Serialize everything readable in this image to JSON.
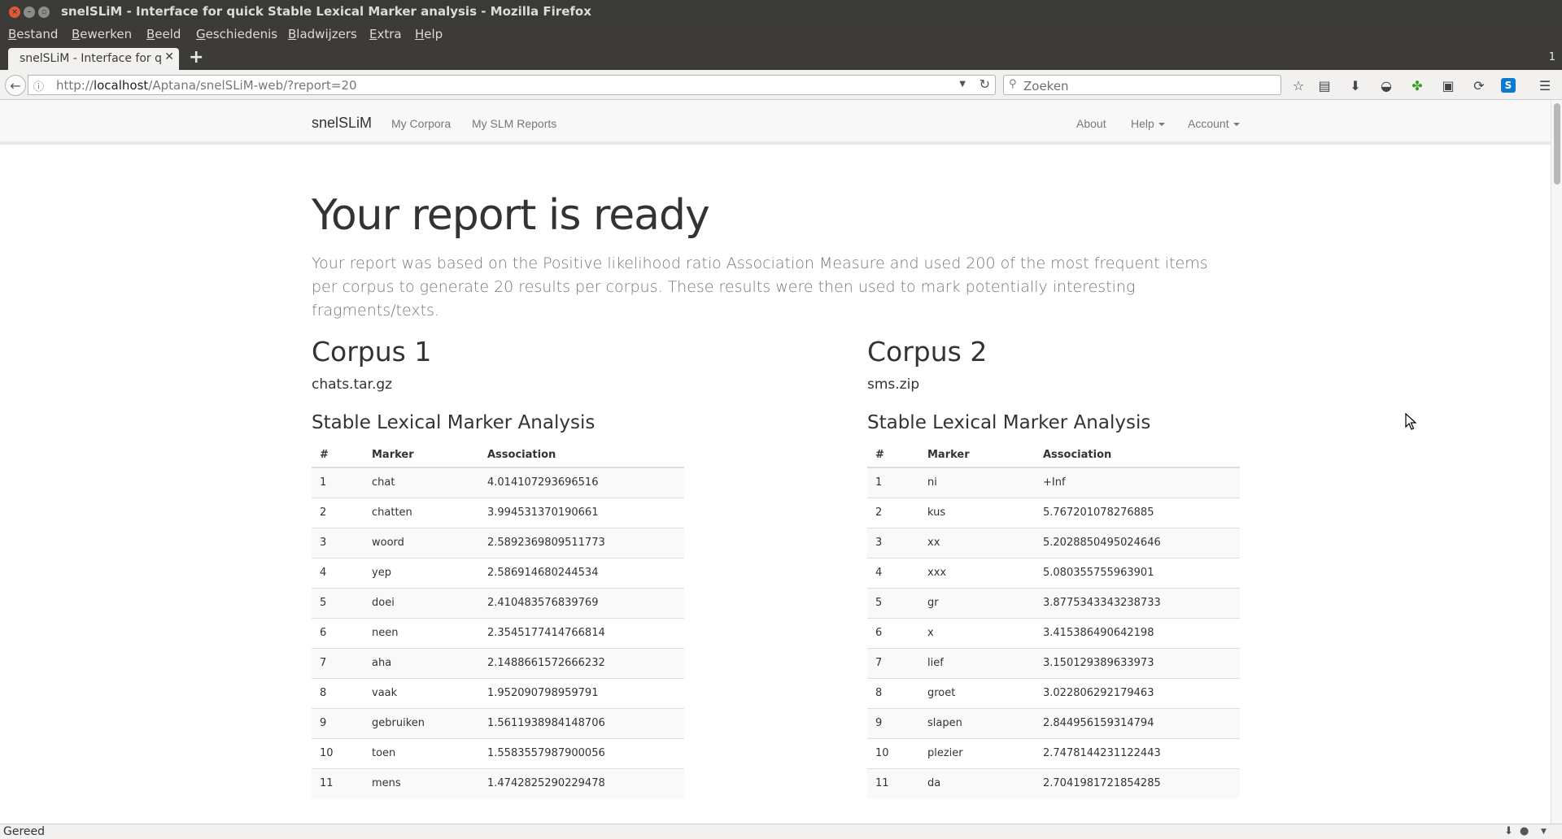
{
  "window": {
    "title": "snelSLiM - Interface for quick Stable Lexical Marker analysis - Mozilla Firefox"
  },
  "menubar": {
    "items": [
      {
        "u": "B",
        "rest": "estand"
      },
      {
        "u": "B",
        "rest": "ewerken"
      },
      {
        "u": "B",
        "rest": "eeld"
      },
      {
        "u": "G",
        "rest": "eschiedenis"
      },
      {
        "u": "B",
        "rest": "ladwijzers"
      },
      {
        "u": "E",
        "rest": "xtra"
      },
      {
        "u": "H",
        "rest": "elp"
      }
    ]
  },
  "tabs": {
    "active_label": "snelSLiM - Interface for q",
    "count": "1"
  },
  "nav": {
    "url_prefix": "http://",
    "url_host": "localhost",
    "url_path": "/Aptana/snelSLiM-web/?report=20",
    "search_placeholder": "Zoeken"
  },
  "site": {
    "brand": "snelSLiM",
    "links_left": [
      "My Corpora",
      "My SLM Reports"
    ],
    "about": "About",
    "help": "Help",
    "account": "Account"
  },
  "report": {
    "heading": "Your report is ready",
    "lead": "Your report was based on the Positive likelihood ratio Association Measure and used 200 of the most frequent items per corpus to generate 20 results per corpus. These results were then used to mark potentially interesting fragments/texts.",
    "section_title": "Stable Lexical Marker Analysis",
    "columns": [
      "#",
      "Marker",
      "Association"
    ],
    "corpora": [
      {
        "title": "Corpus 1",
        "file": "chats.tar.gz",
        "rows": [
          [
            "1",
            "chat",
            "4.014107293696516"
          ],
          [
            "2",
            "chatten",
            "3.994531370190661"
          ],
          [
            "3",
            "woord",
            "2.5892369809511773"
          ],
          [
            "4",
            "yep",
            "2.586914680244534"
          ],
          [
            "5",
            "doei",
            "2.410483576839769"
          ],
          [
            "6",
            "neen",
            "2.3545177414766814"
          ],
          [
            "7",
            "aha",
            "2.1488661572666232"
          ],
          [
            "8",
            "vaak",
            "1.952090798959791"
          ],
          [
            "9",
            "gebruiken",
            "1.5611938984148706"
          ],
          [
            "10",
            "toen",
            "1.5583557987900056"
          ],
          [
            "11",
            "mens",
            "1.4742825290229478"
          ]
        ]
      },
      {
        "title": "Corpus 2",
        "file": "sms.zip",
        "rows": [
          [
            "1",
            "ni",
            "+Inf"
          ],
          [
            "2",
            "kus",
            "5.767201078276885"
          ],
          [
            "3",
            "xx",
            "5.2028850495024646"
          ],
          [
            "4",
            "xxx",
            "5.080355755963901"
          ],
          [
            "5",
            "gr",
            "3.8775343343238733"
          ],
          [
            "6",
            "x",
            "3.415386490642198"
          ],
          [
            "7",
            "lief",
            "3.150129389633973"
          ],
          [
            "8",
            "groet",
            "3.022806292179463"
          ],
          [
            "9",
            "slapen",
            "2.844956159314794"
          ],
          [
            "10",
            "plezier",
            "2.7478144231122443"
          ],
          [
            "11",
            "da",
            "2.7041981721854285"
          ]
        ]
      }
    ]
  },
  "status": {
    "text": "Gereed"
  }
}
